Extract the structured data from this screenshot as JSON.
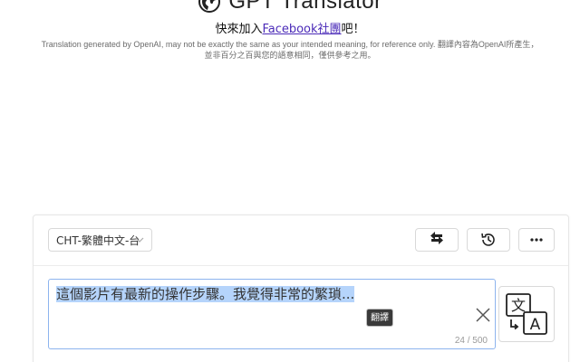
{
  "header": {
    "title": "GPT Translator",
    "join_prefix": "快來加入",
    "join_link": "Facebook社團",
    "join_suffix": "吧！",
    "disclaimer_line1": "Translation generated by OpenAI, may not be exactly the same as your intended meaning, for reference only. 翻譯內容為OpenAI所產生，",
    "disclaimer_line2": "並非百分之百與您的語意相同，僅供參考之用。"
  },
  "toolbar": {
    "language": "CHT-繁體中文-台",
    "swap_icon": "swap-arrows-icon",
    "history_icon": "history-icon",
    "more_icon": "more-dots-icon"
  },
  "input": {
    "value": "這個影片有最新的操作步驟。我覺得非常的繁瑣...",
    "counter": "24 / 500",
    "floating_button": "翻譯",
    "clear_icon": "close-icon",
    "translate_icon": "translate-icon"
  },
  "colors": {
    "accent_border": "#8db4ee",
    "selection": "#b5d4fb",
    "link": "#4b2bb8"
  }
}
